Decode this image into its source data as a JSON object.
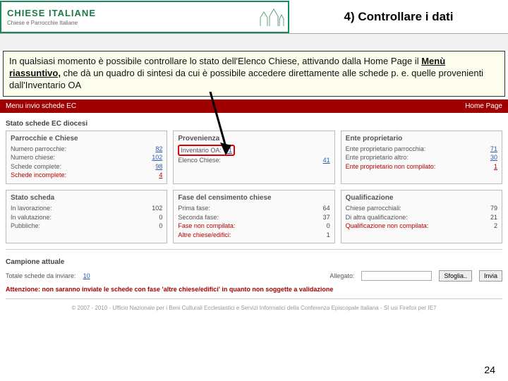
{
  "logo": {
    "main": "CHIESE ITALIANE",
    "sub": "Chiese e Parrocchie Italiane"
  },
  "header_title": "4) Controllare i dati",
  "info_box": {
    "t1": "In qualsiasi momento è possibile controllare lo stato dell'Elenco Chiese, attivando dalla Home Page il ",
    "mr": "Menù riassuntivo,",
    "t2": " che dà un quadro di sintesi da cui è possibile accedere direttamente alle schede p. e. quelle provenienti dall'Inventario OA"
  },
  "menu_bar": {
    "left": "Menu invio schede EC",
    "right": "Home Page"
  },
  "section_state": "Stato schede EC diocesi",
  "card_a": {
    "title": "Parrocchie e Chiese",
    "r1k": "Numero parrocchie:",
    "r1v": "82",
    "r2k": "Numero chiese:",
    "r2v": "102",
    "r3k": "Schede complete:",
    "r3v": "98",
    "r4k": "Schede incomplete:",
    "r4v": "4"
  },
  "card_b": {
    "title": "Provenienza",
    "r1k": "Inventario OA:",
    "r1v": "61",
    "r2k": "Elenco Chiese:",
    "r2v": "41"
  },
  "card_c": {
    "title": "Ente proprietario",
    "r1k": "Ente proprietario parrocchia:",
    "r1v": "71",
    "r2k": "Ente proprietario altro:",
    "r2v": "30",
    "r3k": "Ente proprietario non compilato:",
    "r3v": "1"
  },
  "card_d": {
    "title": "Stato scheda",
    "r1k": "In lavorazione:",
    "r1v": "102",
    "r2k": "In valutazione:",
    "r2v": "0",
    "r3k": "Pubbliche:",
    "r3v": "0"
  },
  "card_e": {
    "title": "Fase del censimento chiese",
    "r1k": "Prima fase:",
    "r1v": "64",
    "r2k": "Seconda fase:",
    "r2v": "37",
    "r3k": "Fase non compilata:",
    "r3v": "0",
    "r4k": "Altre chiese/edifici:",
    "r4v": "1"
  },
  "card_f": {
    "title": "Qualificazione",
    "r1k": "Chiese parrocchiali:",
    "r1v": "79",
    "r2k": "Di altra qualificazione:",
    "r2v": "21",
    "r3k": "Qualificazione non compilata:",
    "r3v": "2"
  },
  "campione_title": "Campione attuale",
  "tot_label": "Totale schede da inviare:",
  "tot_value": "10",
  "allegato_label": "Allegato:",
  "sfoglia": "Sfoglia..",
  "invia": "Invia",
  "warn_line": "Attenzione: non saranno inviate le schede con fase 'altre chiese/edifici' in quanto non soggette a validazione",
  "footer": "© 2007 - 2010 - Ufficio Nazionale per i Beni Culturali Ecclesiastici e Servizi Informatici della Conferenza Episcopale Italiana - SI usi Firefox per IE7",
  "page_num": "24"
}
